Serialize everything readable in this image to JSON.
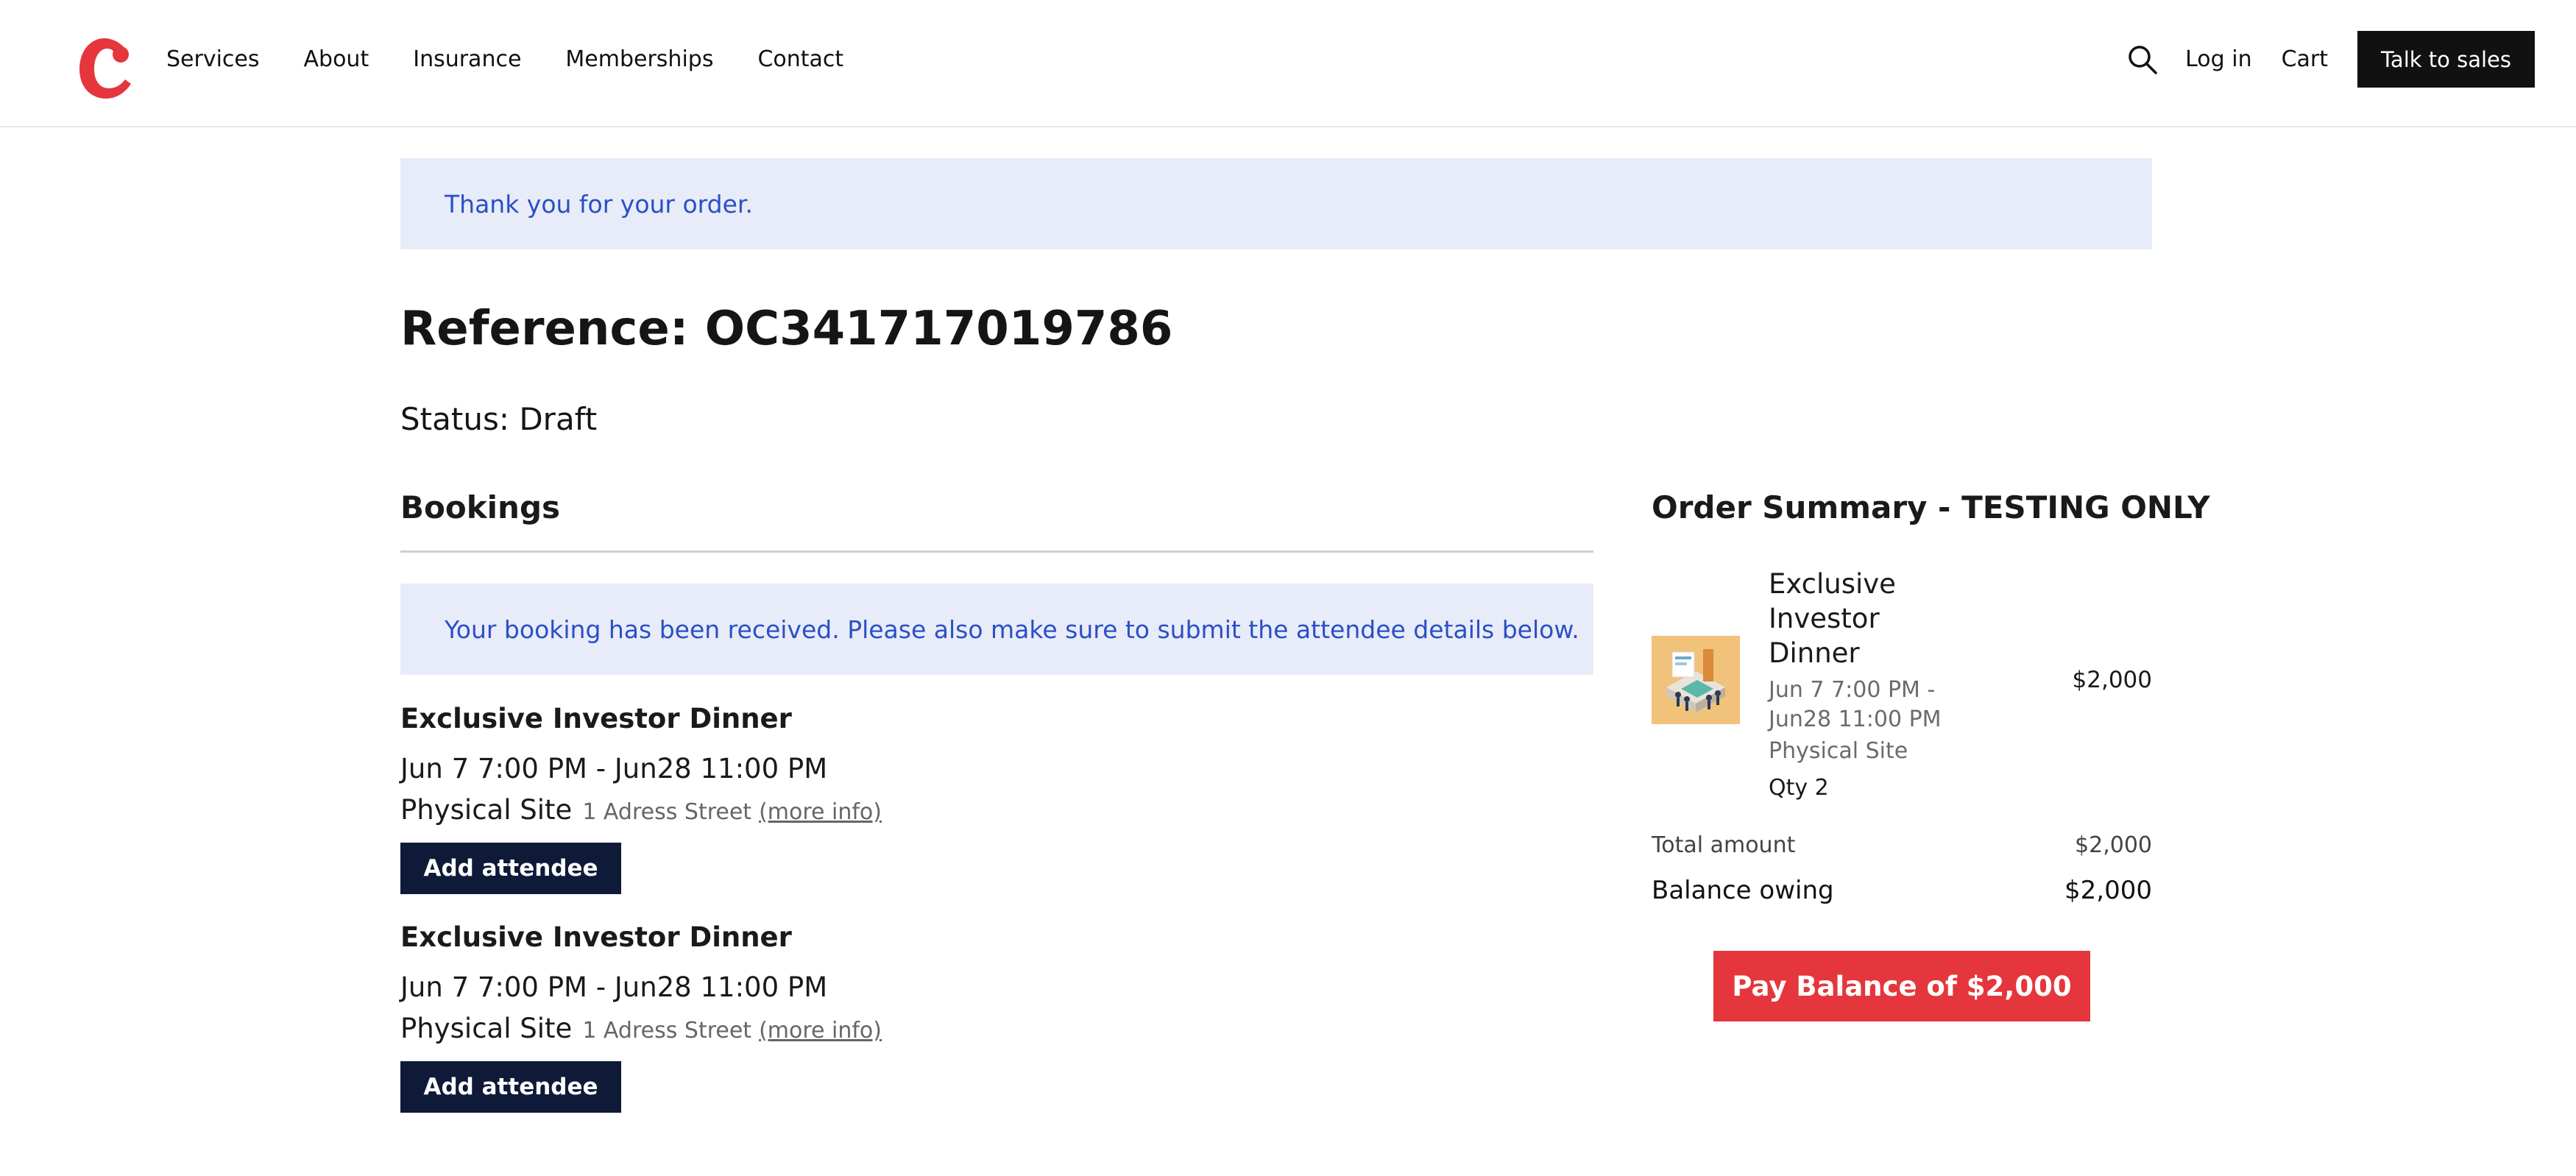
{
  "header": {
    "logo_icon": "brand-c-logo",
    "nav": [
      "Services",
      "About",
      "Insurance",
      "Memberships",
      "Contact"
    ],
    "search_icon": "search-icon",
    "login_label": "Log in",
    "cart_label": "Cart",
    "sales_label": "Talk to sales"
  },
  "colors": {
    "brand_red": "#e5363d",
    "alert_bg": "#e8ecf8",
    "alert_text": "#2a4fc6",
    "dark_button": "#0e1a38"
  },
  "alert_top": "Thank you for your order.",
  "reference": "Reference: OC341717019786",
  "status": "Status: Draft",
  "bookings": {
    "title": "Bookings",
    "notice": "Your booking has been received. Please also make sure to submit the attendee details below.",
    "items": [
      {
        "name": "Exclusive Investor Dinner",
        "date": "Jun 7 7:00 PM - Jun28 11:00 PM",
        "site": "Physical Site",
        "address": "1 Adress Street",
        "more": "(more info)",
        "button": "Add attendee"
      },
      {
        "name": "Exclusive Investor Dinner",
        "date": "Jun 7 7:00 PM - Jun28 11:00 PM",
        "site": "Physical Site",
        "address": "1 Adress Street",
        "more": "(more info)",
        "button": "Add attendee"
      }
    ]
  },
  "summary": {
    "title": "Order Summary - TESTING ONLY",
    "item": {
      "name": "Exclusive Investor Dinner",
      "date": "Jun 7 7:00 PM - Jun28 11:00 PM",
      "site": "Physical Site",
      "qty": "Qty 2",
      "price": "$2,000"
    },
    "total_label": "Total amount",
    "total_value": "$2,000",
    "balance_label": "Balance owing",
    "balance_value": "$2,000",
    "pay_button": "Pay Balance of $2,000"
  }
}
